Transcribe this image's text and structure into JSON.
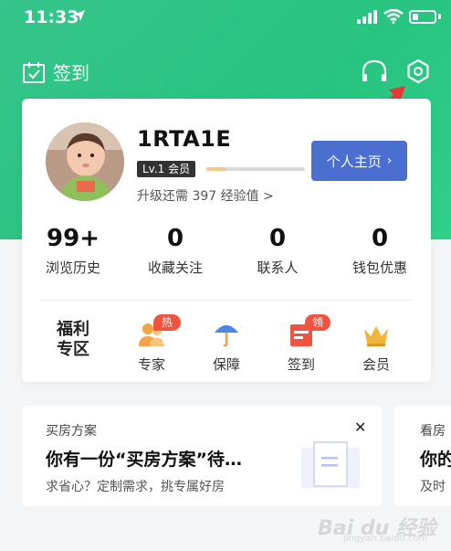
{
  "status_bar": {
    "time": "11:33"
  },
  "header": {
    "checkin_label": "签到"
  },
  "profile": {
    "name": "1RTA1E",
    "level": "Lv.1 会员",
    "exp_progress": 0.2,
    "upgrade_hint": "升级还需 397 经验值 >",
    "homepage_button": "个人主页"
  },
  "stats": [
    {
      "value": "99+",
      "label": "浏览历史"
    },
    {
      "value": "0",
      "label": "收藏关注"
    },
    {
      "value": "0",
      "label": "联系人"
    },
    {
      "value": "0",
      "label": "钱包优惠"
    }
  ],
  "quick": {
    "welfare_line1": "福利",
    "welfare_line2": "专区",
    "items": [
      {
        "label": "专家",
        "badge": "热门",
        "icon": "experts-icon"
      },
      {
        "label": "保障",
        "badge": "",
        "icon": "umbrella-icon"
      },
      {
        "label": "签到",
        "badge": "领钱",
        "icon": "checkin-calendar-icon"
      },
      {
        "label": "会员",
        "badge": "",
        "icon": "crown-icon"
      }
    ]
  },
  "cards": [
    {
      "header": "买房方案",
      "title": "你有一份“买房方案”待…",
      "desc": "求省心？定制需求，挑专属好房"
    },
    {
      "header": "看房",
      "title": "你的",
      "desc": "及时"
    }
  ],
  "watermark": {
    "brand": "Bai du 经验",
    "url": "jingyan.baidu.com"
  },
  "colors": {
    "hero_green": "#2fc98a",
    "primary_blue": "#4a6fd1",
    "badge_red": "#f0533e",
    "annotation_red": "#e53935"
  }
}
